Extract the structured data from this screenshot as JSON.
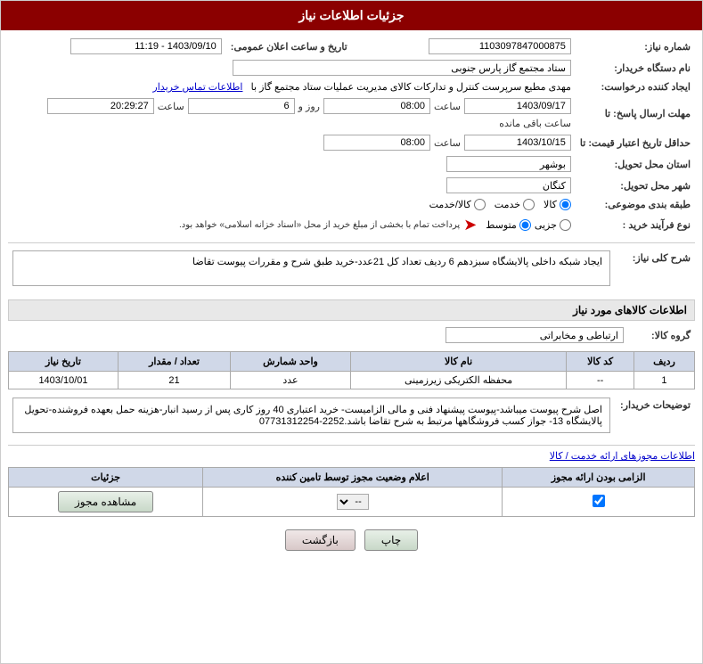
{
  "page": {
    "title": "جزئیات اطلاعات نیاز"
  },
  "fields": {
    "need_number_label": "شماره نیاز:",
    "need_number_value": "1103097847000875",
    "buyer_name_label": "نام دستگاه خریدار:",
    "buyer_name_value": "ستاد مجتمع گاز پارس جنوبی",
    "creator_label": "ایجاد کننده درخواست:",
    "creator_value": "مهدی مطیع سرپرست کنترل و تدارکات کالای مدیریت عملیات ستاد مجتمع گاز با",
    "creator_link": "اطلاعات تماس خریدار",
    "date_label": "تاریخ و ساعت اعلان عمومی:",
    "date_value": "1403/09/10 - 11:19",
    "reply_deadline_label": "مهلت ارسال پاسخ: تا",
    "reply_date": "1403/09/17",
    "reply_time": "08:00",
    "reply_days": "6",
    "reply_hours": "20:29:27",
    "price_deadline_label": "حداقل تاریخ اعتبار قیمت: تا",
    "price_date": "1403/10/15",
    "price_time": "08:00",
    "province_label": "استان محل تحویل:",
    "province_value": "بوشهر",
    "city_label": "شهر محل تحویل:",
    "city_value": "کنگان",
    "category_label": "طبقه بندی موضوعی:",
    "category_options": [
      "کالا",
      "خدمت",
      "کالا/خدمت"
    ],
    "category_selected": "کالا",
    "purchase_type_label": "نوع فرآیند خرید :",
    "purchase_options": [
      "جزیی",
      "متوسط"
    ],
    "purchase_note": "پرداخت تمام با بخشی از مبلغ خرید از محل «اسناد خزانه اسلامی» خواهد بود.",
    "need_desc_label": "شرح کلی نیاز:",
    "need_desc_value": "ایجاد شبکه داخلی پالایشگاه سبزدهم 6 ردیف تعداد کل 21عدد-خرید طبق شرح و مقررات پیوست تقاضا",
    "goods_info_title": "اطلاعات کالاهای مورد نیاز",
    "goods_group_label": "گروه کالا:",
    "goods_group_value": "ارتباطی و مخابراتی",
    "table": {
      "headers": [
        "ردیف",
        "کد کالا",
        "نام کالا",
        "واحد شمارش",
        "تعداد / مقدار",
        "تاریخ نیاز"
      ],
      "rows": [
        {
          "row": "1",
          "code": "--",
          "name": "محفظه الکتریکی زیرزمینی",
          "unit": "عدد",
          "quantity": "21",
          "date": "1403/10/01"
        }
      ]
    },
    "buyer_notes_label": "توضیحات خریدار:",
    "buyer_notes_value": "اصل شرح پیوست میباشد-پیوست پیشنهاد فنی و مالی الزامیست- خرید اعتباری 40 روز کاری پس از رسید انبار-هزینه حمل بعهده فروشنده-تحویل پالایشگاه 13- جواز کسب فروشگاهها مرتبط به شرح تقاضا باشد.2252-07731312254",
    "supply_section_title": "اطلاعات مجوزهای ارائه خدمت / کالا",
    "supply_table": {
      "headers": [
        "الزامی بودن ارائه مجوز",
        "اعلام وضعیت مجوز توسط تامین کننده",
        "جزئیات"
      ],
      "rows": [
        {
          "mandatory": true,
          "status_options": [
            "--"
          ],
          "status_selected": "--",
          "detail_btn": "مشاهده مجوز"
        }
      ]
    }
  },
  "actions": {
    "print_label": "چاپ",
    "back_label": "بازگشت"
  },
  "labels": {
    "day_label": "روز و",
    "hour_label": "ساعت باقی مانده"
  }
}
